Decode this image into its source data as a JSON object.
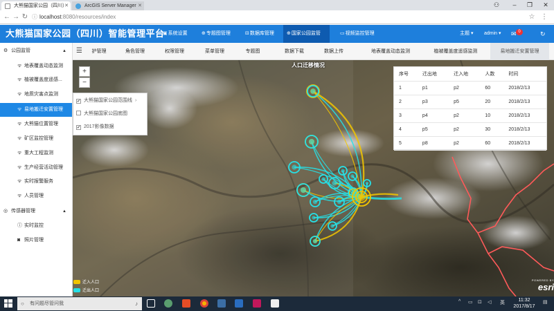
{
  "browser": {
    "tabs": [
      {
        "title": "大熊猫国家公园（四川）"
      },
      {
        "title": "ArcGIS Server Manager"
      }
    ],
    "url": "localhost:8080/resources/index",
    "url_host": "localhost",
    "url_rest": ":8080/resources/index"
  },
  "header": {
    "title": "大熊猫国家公园（四川）智能管理平台",
    "nav": [
      {
        "label": "系统设置"
      },
      {
        "label": "专题图管理"
      },
      {
        "label": "数据库管理"
      },
      {
        "label": "国家公园监管"
      },
      {
        "label": "视频监控管理"
      }
    ],
    "theme_label": "主题",
    "user": "admin",
    "notification_count": "0"
  },
  "sidebar": {
    "items": [
      {
        "label": "公园监管"
      },
      {
        "label": "地表覆盖动态监测"
      },
      {
        "label": "植被覆盖度遥感..."
      },
      {
        "label": "地质灾害点监测"
      },
      {
        "label": "易地搬迁安置管理"
      },
      {
        "label": "大熊猫位置管理"
      },
      {
        "label": "矿区监控管理"
      },
      {
        "label": "重大工程监测"
      },
      {
        "label": "生产经营活动管理"
      },
      {
        "label": "实时报警服务"
      },
      {
        "label": "人员管理"
      },
      {
        "label": "传感器管理"
      },
      {
        "label": "实时监控"
      },
      {
        "label": "照片管理"
      }
    ]
  },
  "page_tabs": [
    {
      "label": "护管理"
    },
    {
      "label": "角色管理"
    },
    {
      "label": "权限管理"
    },
    {
      "label": "菜单管理"
    },
    {
      "label": "专题图"
    },
    {
      "label": "数据下载"
    },
    {
      "label": "数据上传"
    },
    {
      "label": "地表覆盖动态监测"
    },
    {
      "label": "植被覆盖度遥感监测"
    },
    {
      "label": "易地搬迁安置管理"
    }
  ],
  "map": {
    "title": "人口迁移情况",
    "zoom_in": "+",
    "zoom_out": "−",
    "layers": [
      {
        "label": "大熊猫国家公园范围线",
        "checked": true
      },
      {
        "label": "大熊猫国家公园底图",
        "checked": false
      },
      {
        "label": "2017影像数据",
        "checked": true
      }
    ],
    "legend": [
      {
        "label": "迁入人口",
        "color": "#f2c500"
      },
      {
        "label": "迁出人口",
        "color": "#26e0e6"
      }
    ],
    "attribution_small": "POWERED BY",
    "attribution": "esri",
    "colors": {
      "in": "#f2c500",
      "out": "#26e0e6",
      "boundary": "#ff5a5a"
    }
  },
  "migration_table": {
    "headers": [
      "序号",
      "迁出地",
      "迁入地",
      "人数",
      "时间"
    ],
    "rows": [
      [
        "1",
        "p1",
        "p2",
        "60",
        "2018/2/13"
      ],
      [
        "2",
        "p3",
        "p5",
        "20",
        "2018/2/13"
      ],
      [
        "3",
        "p4",
        "p2",
        "10",
        "2018/2/13"
      ],
      [
        "4",
        "p5",
        "p2",
        "30",
        "2018/2/13"
      ],
      [
        "5",
        "p8",
        "p2",
        "60",
        "2018/2/13"
      ]
    ]
  },
  "taskbar": {
    "search_placeholder": "有问题尽管问我",
    "time": "11:32",
    "date": "2017/8/17",
    "ime": "英"
  }
}
